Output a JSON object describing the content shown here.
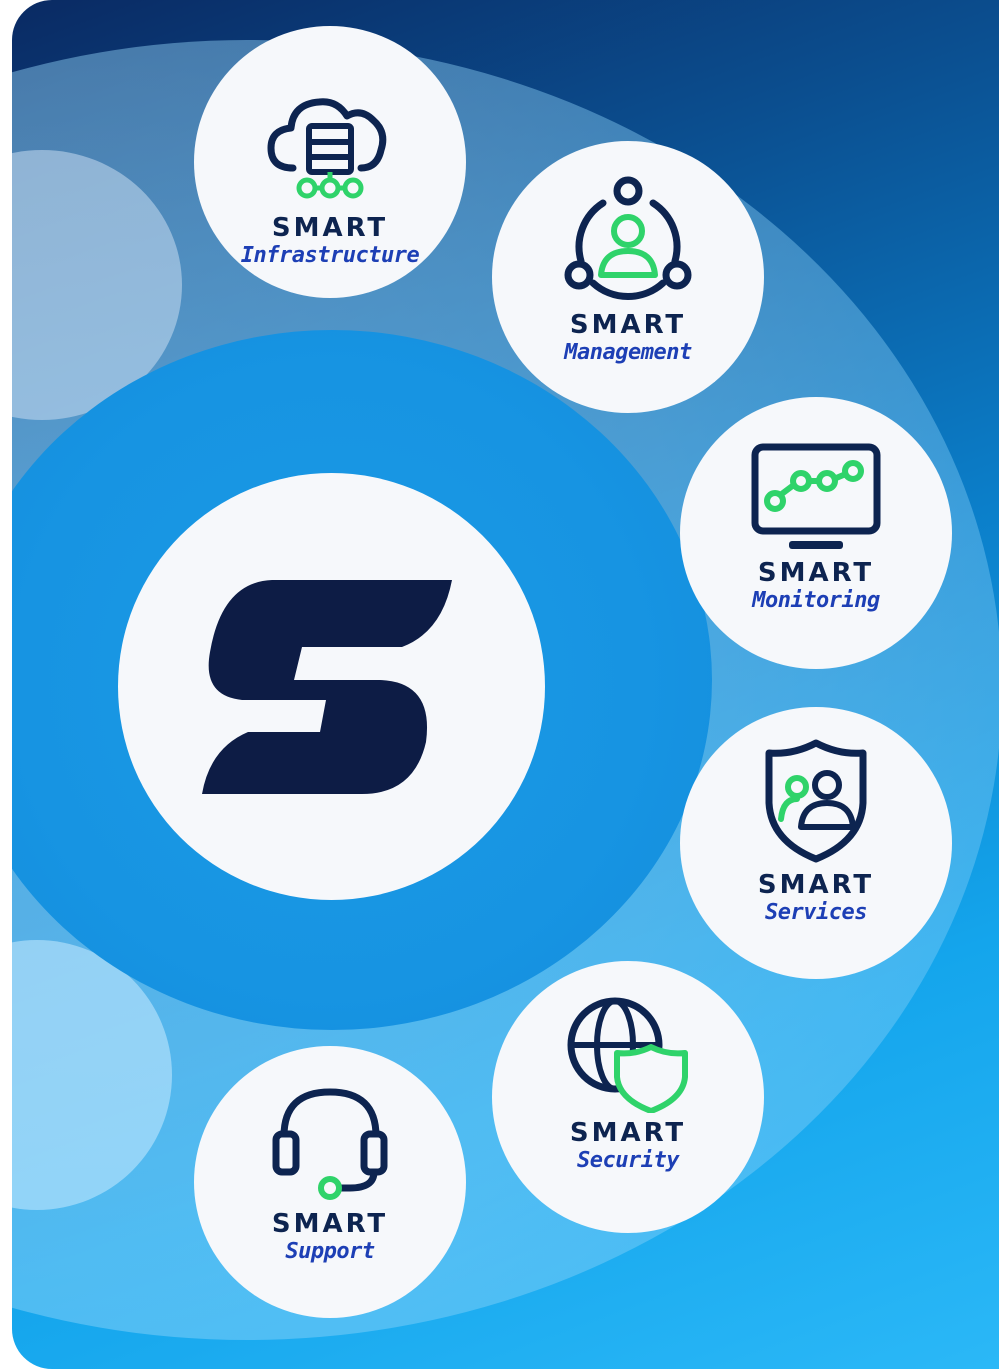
{
  "brand": {
    "logo": "hostinger-style-s-logo",
    "colors": {
      "navy": "#0d2450",
      "blue_text": "#1d3fb5",
      "green": "#2fd36a",
      "disc": "#f6f8fb"
    }
  },
  "services": [
    {
      "prefix": "SMART",
      "name": "Infrastructure",
      "icon": "cloud-server-icon"
    },
    {
      "prefix": "SMART",
      "name": "Management",
      "icon": "team-network-icon"
    },
    {
      "prefix": "SMART",
      "name": "Monitoring",
      "icon": "monitor-graph-icon"
    },
    {
      "prefix": "SMART",
      "name": "Services",
      "icon": "shield-users-icon"
    },
    {
      "prefix": "SMART",
      "name": "Security",
      "icon": "globe-shield-icon"
    },
    {
      "prefix": "SMART",
      "name": "Support",
      "icon": "headset-icon"
    }
  ]
}
